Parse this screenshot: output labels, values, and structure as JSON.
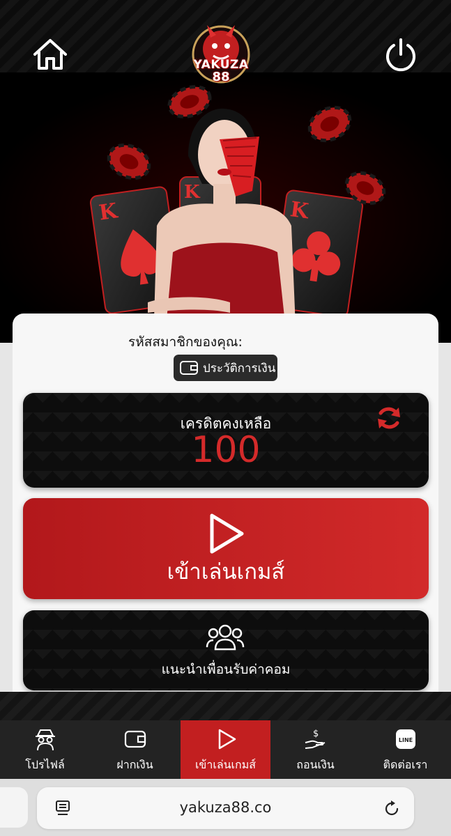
{
  "header": {
    "logo_text": "YAKUZA",
    "logo_number": "88"
  },
  "account": {
    "member_label": "รหัสสมาชิกของคุณ:",
    "history_label": "ประวัติการเงิน"
  },
  "credit": {
    "label": "เครดิตคงเหลือ",
    "value": "100"
  },
  "play": {
    "label": "เข้าเล่นเกมส์"
  },
  "invite": {
    "label": "แนะนำเพื่อนรับค่าคอม"
  },
  "nav": {
    "items": [
      {
        "label": "โปรไฟล์",
        "icon": "spy-icon"
      },
      {
        "label": "ฝากเงิน",
        "icon": "wallet-icon"
      },
      {
        "label": "เข้าเล่นเกมส์",
        "icon": "play-icon",
        "active": true
      },
      {
        "label": "ถอนเงิน",
        "icon": "hand-money-icon"
      },
      {
        "label": "ติดต่อเรา",
        "icon": "line-icon",
        "badge": "LINE"
      }
    ]
  },
  "browser": {
    "url": "yakuza88.co"
  },
  "colors": {
    "accent_red": "#c21f20",
    "credit_red": "#d42a2a",
    "panel_black": "#0d0d0d"
  }
}
